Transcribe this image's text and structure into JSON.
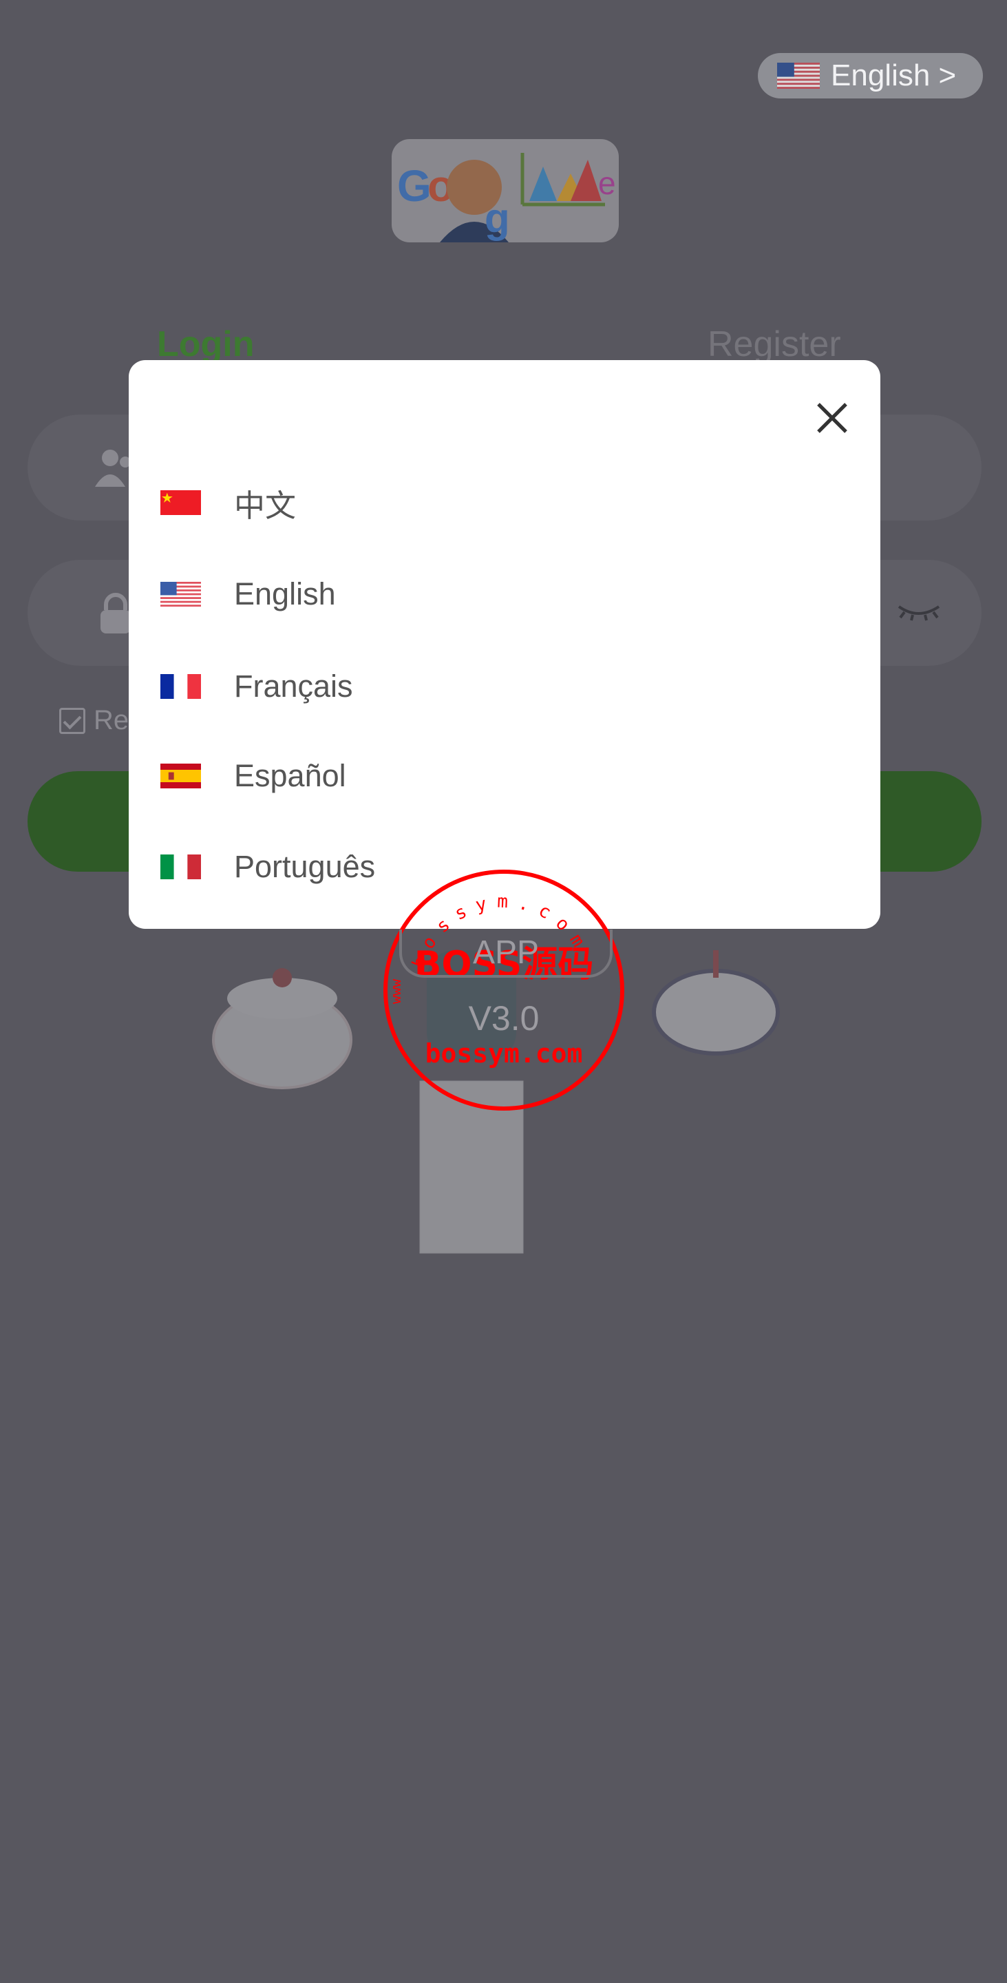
{
  "header": {
    "language_button": "English >",
    "language_flag": "us-flag-icon"
  },
  "tabs": [
    {
      "label": "Login",
      "active": true,
      "color": "#6ed06a"
    },
    {
      "label": "Register",
      "active": false
    }
  ],
  "form": {
    "remember_label": "Re",
    "login_button_color": "#55b23f"
  },
  "app": {
    "badge": "APP",
    "version": "V3.0"
  },
  "language_modal": {
    "close_icon": "close-icon",
    "items": [
      {
        "label": "中文",
        "flag": "cn"
      },
      {
        "label": "English",
        "flag": "us"
      },
      {
        "label": "Français",
        "flag": "fr"
      },
      {
        "label": "Español",
        "flag": "es"
      },
      {
        "label": "Português",
        "flag": "it"
      }
    ]
  },
  "watermark": {
    "top_arc": "bossym.com",
    "main": "BOSS源码",
    "sub": "bossym.com",
    "side": "www"
  }
}
